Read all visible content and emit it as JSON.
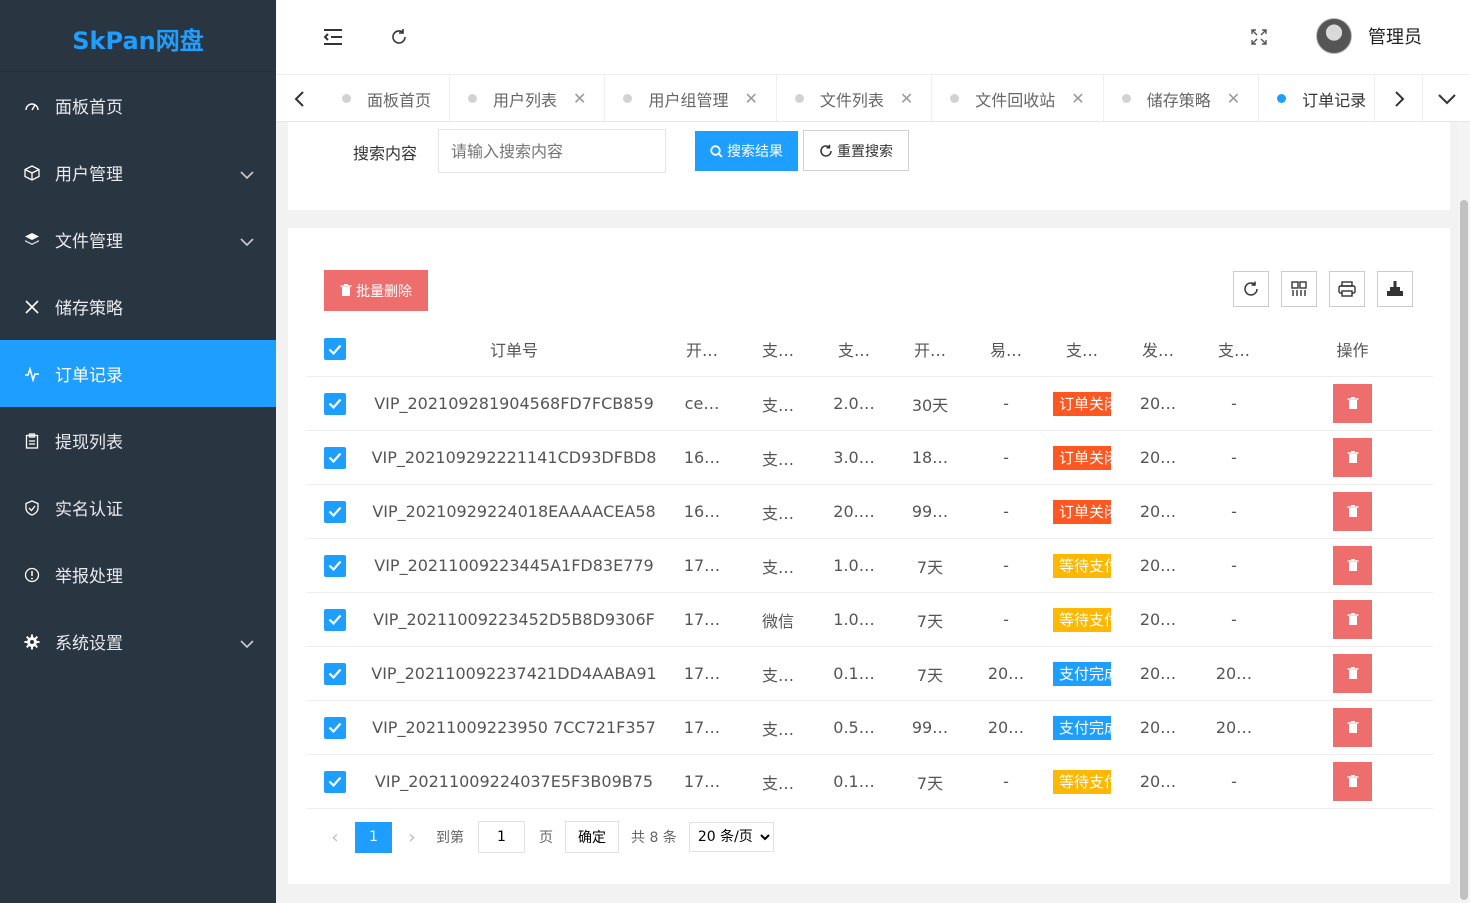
{
  "app": {
    "logo": "SkPan网盘"
  },
  "sidebar": {
    "items": [
      {
        "label": "面板首页",
        "icon": "dashboard-icon",
        "active": false,
        "expandable": false
      },
      {
        "label": "用户管理",
        "icon": "cube-icon",
        "active": false,
        "expandable": true
      },
      {
        "label": "文件管理",
        "icon": "layers-icon",
        "active": false,
        "expandable": true
      },
      {
        "label": "储存策略",
        "icon": "tools-icon",
        "active": false,
        "expandable": false
      },
      {
        "label": "订单记录",
        "icon": "pulse-icon",
        "active": true,
        "expandable": false
      },
      {
        "label": "提现列表",
        "icon": "clipboard-icon",
        "active": false,
        "expandable": false
      },
      {
        "label": "实名认证",
        "icon": "shield-check-icon",
        "active": false,
        "expandable": false
      },
      {
        "label": "举报处理",
        "icon": "info-circle-icon",
        "active": false,
        "expandable": false
      },
      {
        "label": "系统设置",
        "icon": "gear-icon",
        "active": false,
        "expandable": true
      }
    ]
  },
  "header": {
    "user_name": "管理员"
  },
  "tabs": [
    {
      "label": "面板首页",
      "closable": false,
      "active": false
    },
    {
      "label": "用户列表",
      "closable": true,
      "active": false
    },
    {
      "label": "用户组管理",
      "closable": true,
      "active": false
    },
    {
      "label": "文件列表",
      "closable": true,
      "active": false
    },
    {
      "label": "文件回收站",
      "closable": true,
      "active": false
    },
    {
      "label": "储存策略",
      "closable": true,
      "active": false
    },
    {
      "label": "订单记录",
      "closable": false,
      "active": true
    }
  ],
  "search": {
    "label": "搜索内容",
    "placeholder": "请输入搜索内容",
    "search_button": "搜索结果",
    "reset_button": "重置搜索"
  },
  "toolbar": {
    "batch_delete": "批量删除"
  },
  "table": {
    "headers": [
      "订单号",
      "开…",
      "支…",
      "支…",
      "开…",
      "易…",
      "支…",
      "发…",
      "支…",
      "操作"
    ],
    "rows": [
      {
        "order": "VIP_202109281904568FD7FCB859",
        "c1": "ce…",
        "c2": "支…",
        "c3": "2.0…",
        "c4": "30天",
        "c5": "-",
        "status": "订单关闭",
        "status_color": "#ff5722",
        "c7": "20…",
        "c8": "-"
      },
      {
        "order": "VIP_202109292221141CD93DFBD8",
        "c1": "16…",
        "c2": "支…",
        "c3": "3.0…",
        "c4": "18…",
        "c5": "-",
        "status": "订单关闭",
        "status_color": "#ff5722",
        "c7": "20…",
        "c8": "-"
      },
      {
        "order": "VIP_20210929224018EAAAACEA58",
        "c1": "16…",
        "c2": "支…",
        "c3": "20.…",
        "c4": "99…",
        "c5": "-",
        "status": "订单关闭",
        "status_color": "#ff5722",
        "c7": "20…",
        "c8": "-"
      },
      {
        "order": "VIP_20211009223445A1FD83E779",
        "c1": "17…",
        "c2": "支…",
        "c3": "1.0…",
        "c4": "7天",
        "c5": "-",
        "status": "等待支付",
        "status_color": "#ffb800",
        "c7": "20…",
        "c8": "-"
      },
      {
        "order": "VIP_20211009223452D5B8D9306F",
        "c1": "17…",
        "c2": "微信",
        "c3": "1.0…",
        "c4": "7天",
        "c5": "-",
        "status": "等待支付",
        "status_color": "#ffb800",
        "c7": "20…",
        "c8": "-"
      },
      {
        "order": "VIP_202110092237421DD4AABA91",
        "c1": "17…",
        "c2": "支…",
        "c3": "0.1…",
        "c4": "7天",
        "c5": "20…",
        "status": "支付完成",
        "status_color": "#1e9fff",
        "c7": "20…",
        "c8": "20…"
      },
      {
        "order": "VIP_20211009223950 7CC721F357",
        "c1": "17…",
        "c2": "支…",
        "c3": "0.5…",
        "c4": "99…",
        "c5": "20…",
        "status": "支付完成",
        "status_color": "#1e9fff",
        "c7": "20…",
        "c8": "20…"
      },
      {
        "order": "VIP_20211009224037E5F3B09B75",
        "c1": "17…",
        "c2": "支…",
        "c3": "0.1…",
        "c4": "7天",
        "c5": "-",
        "status": "等待支付",
        "status_color": "#ffb800",
        "c7": "20…",
        "c8": "-"
      }
    ]
  },
  "pagination": {
    "current_page": "1",
    "goto_label": "到第",
    "goto_value": "1",
    "page_unit": "页",
    "confirm": "确定",
    "total": "共 8 条",
    "page_size": "20 条/页"
  }
}
